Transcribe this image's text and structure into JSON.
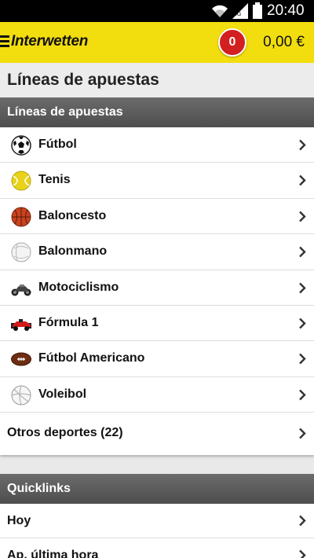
{
  "status": {
    "time": "20:40"
  },
  "header": {
    "brand": "Interwetten",
    "badge": "0",
    "balance": "0,00 €"
  },
  "page": {
    "title": "Líneas de apuestas"
  },
  "section1": {
    "title": "Líneas de apuestas",
    "items": [
      {
        "label": "Fútbol",
        "icon": "soccer-ball-icon"
      },
      {
        "label": "Tenis",
        "icon": "tennis-ball-icon"
      },
      {
        "label": "Baloncesto",
        "icon": "basketball-icon"
      },
      {
        "label": "Balonmano",
        "icon": "handball-icon"
      },
      {
        "label": "Motociclismo",
        "icon": "motorcycle-icon"
      },
      {
        "label": "Fórmula 1",
        "icon": "formula1-car-icon"
      },
      {
        "label": "Fútbol Americano",
        "icon": "american-football-icon"
      },
      {
        "label": "Voleibol",
        "icon": "volleyball-icon"
      }
    ],
    "other": "Otros deportes (22)"
  },
  "section2": {
    "title": "Quicklinks",
    "items": [
      {
        "label": "Hoy"
      },
      {
        "label": "Ap. última hora"
      }
    ]
  },
  "colors": {
    "brand_yellow": "#f2dd0f",
    "badge_red": "#d21f1f",
    "section_gray": "#5a5a5a"
  }
}
